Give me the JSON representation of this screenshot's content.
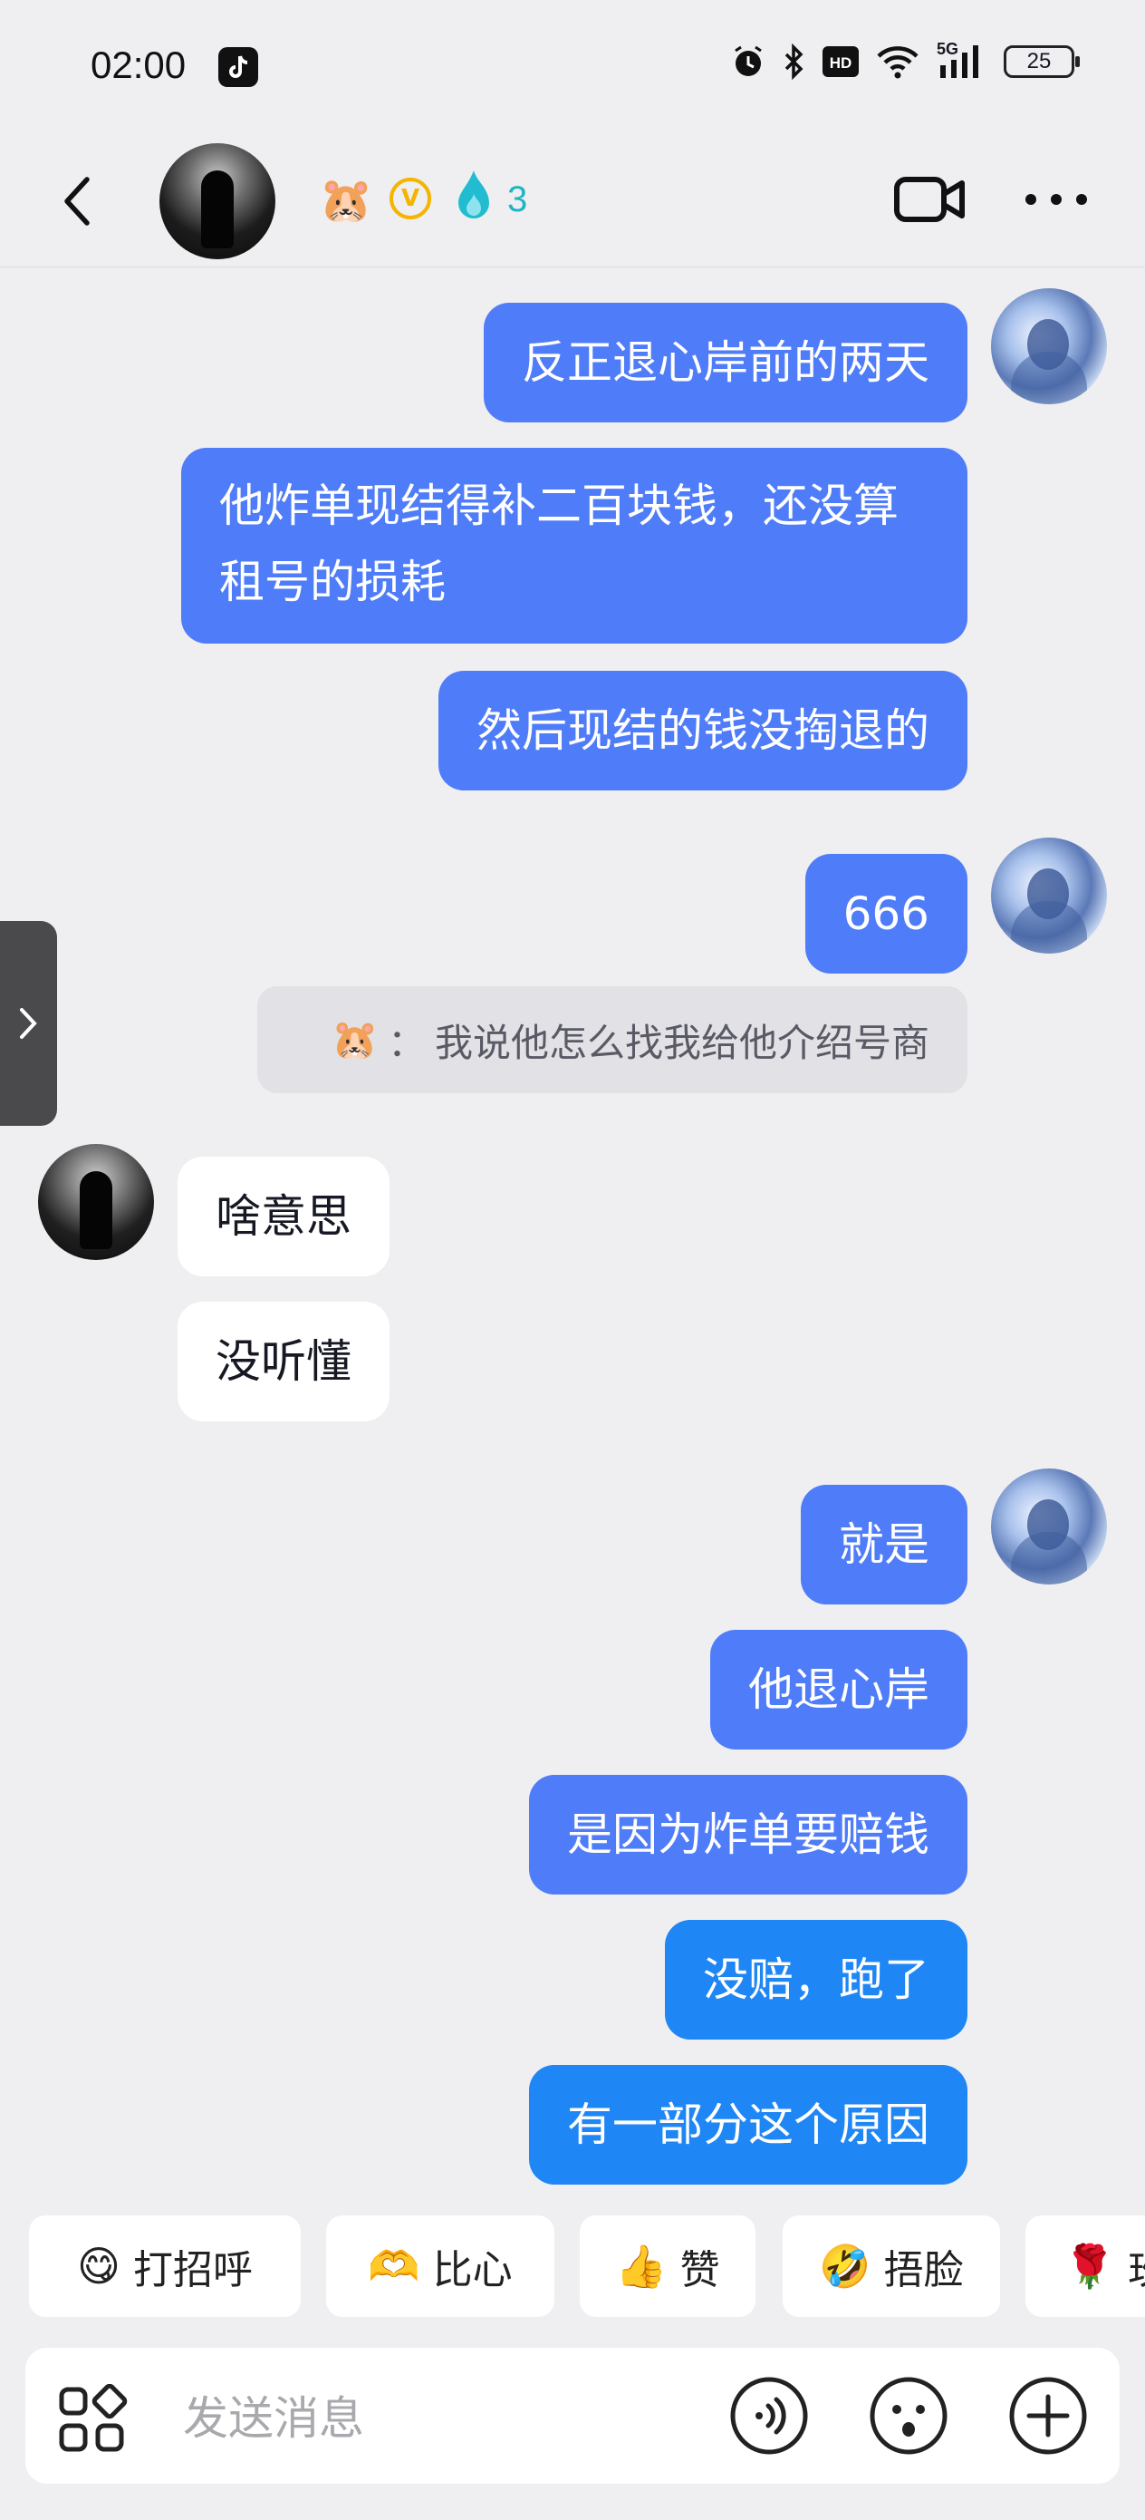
{
  "status_bar": {
    "time": "02:00",
    "network": "5G",
    "battery": "25"
  },
  "header": {
    "flame_count": "3",
    "hamster_emoji": "🐹",
    "verified_letter": "V"
  },
  "messages": [
    {
      "side": "out",
      "text": "反正退心岸前的两天"
    },
    {
      "side": "out",
      "text": "他炸单现结得补二百块钱，还没算租号的损耗"
    },
    {
      "side": "out",
      "text": "然后现结的钱没掏退的"
    },
    {
      "side": "out",
      "text": "666"
    },
    {
      "side": "in",
      "text": "啥意思"
    },
    {
      "side": "in",
      "text": "没听懂"
    },
    {
      "side": "out",
      "text": "就是"
    },
    {
      "side": "out",
      "text": "他退心岸"
    },
    {
      "side": "out",
      "text": "是因为炸单要赔钱"
    },
    {
      "side": "out",
      "text": "没赔，跑了"
    },
    {
      "side": "out",
      "text": "有一部分这个原因"
    }
  ],
  "quote": {
    "emoji": "🐹",
    "separator": "：",
    "text": "我说他怎么找我给他介绍号商"
  },
  "quick_replies": [
    {
      "emoji": "😋",
      "label": "打招呼"
    },
    {
      "emoji": "🫶",
      "label": "比心"
    },
    {
      "emoji": "👍",
      "label": "赞"
    },
    {
      "emoji": "🤣",
      "label": "捂脸"
    },
    {
      "emoji": "🌹",
      "label": "玫瑰"
    }
  ],
  "input": {
    "placeholder": "发送消息"
  },
  "colors": {
    "outgoing_bubble": "#4f7cf8",
    "outgoing_bubble_latest": "#1f86f5",
    "incoming_bubble": "#ffffff",
    "background": "#efeff1"
  }
}
